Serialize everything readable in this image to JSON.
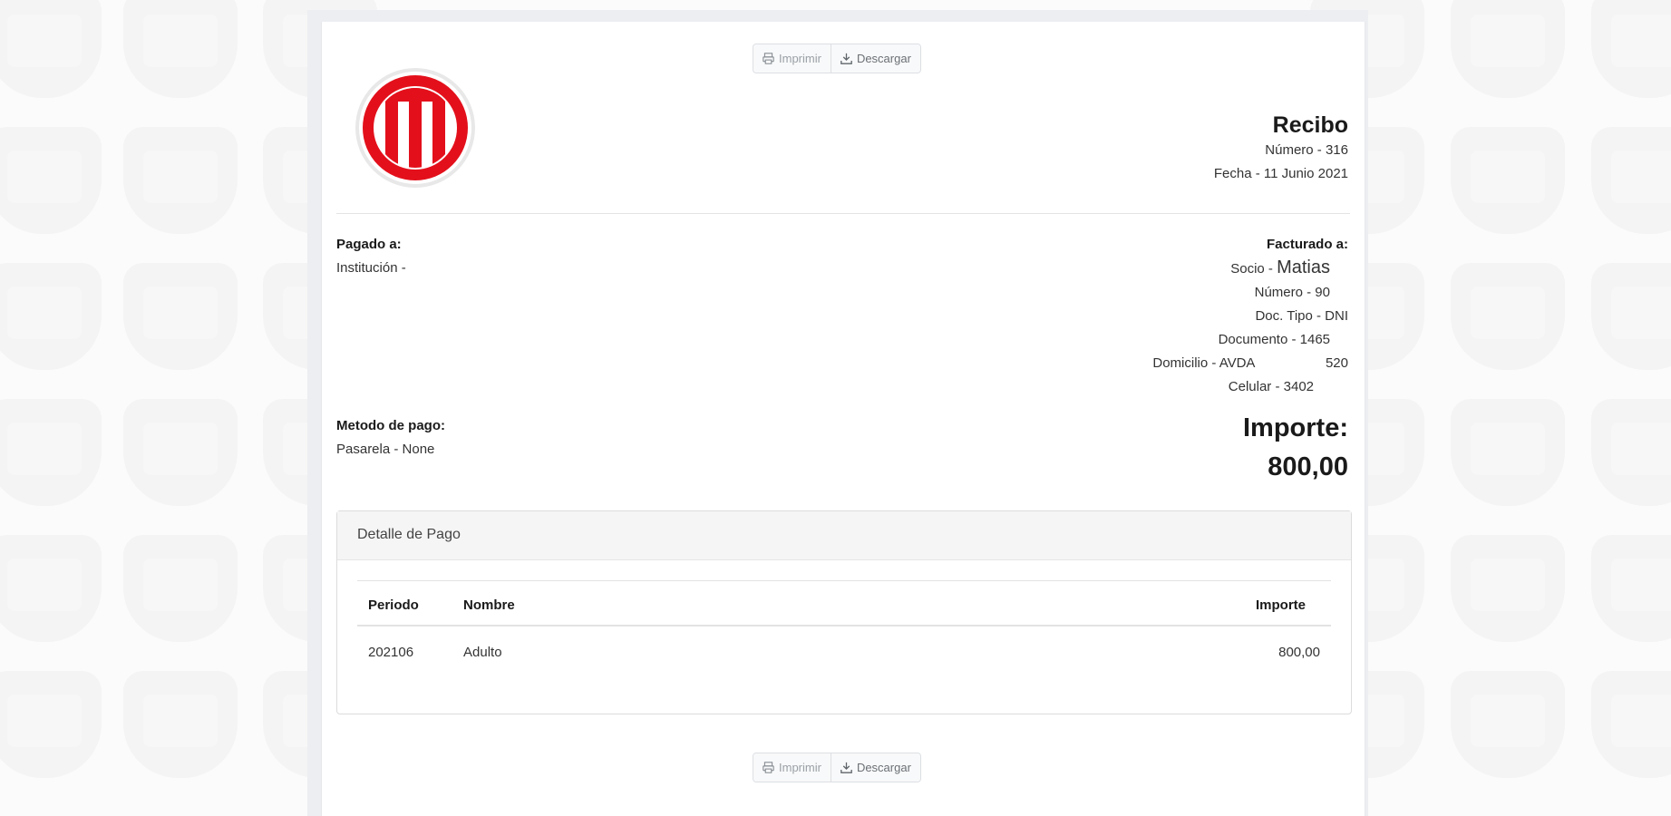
{
  "actions": {
    "print_label": "Imprimir",
    "download_label": "Descargar",
    "print_icon": "printer-icon",
    "download_icon": "download-icon"
  },
  "receipt": {
    "title": "Recibo",
    "numero": "Número - 316",
    "fecha": "Fecha - 11 Junio 2021"
  },
  "paid_to": {
    "heading": "Pagado a:",
    "institucion": "Institución -"
  },
  "billed_to": {
    "heading": "Facturado a:",
    "socio_prefix": "Socio -",
    "socio_name": "Matias",
    "numero": "Número - 90",
    "doc_tipo": "Doc. Tipo - DNI",
    "documento": "Documento - 1465",
    "domicilio": "Domicilio - AVDA",
    "domicilio_num": "520",
    "celular": "Celular - 3402"
  },
  "payment_method": {
    "heading": "Metodo de pago:",
    "value": "Pasarela - None"
  },
  "amount": {
    "label": "Importe:",
    "value": "800,00"
  },
  "detail": {
    "heading": "Detalle de Pago",
    "columns": [
      "Periodo",
      "Nombre",
      "Importe"
    ],
    "rows": [
      {
        "periodo": "202106",
        "nombre": "Adulto",
        "importe": "800,00"
      }
    ]
  },
  "colors": {
    "brand_red": "#e3101b",
    "page_bg": "#fbfbfb"
  }
}
